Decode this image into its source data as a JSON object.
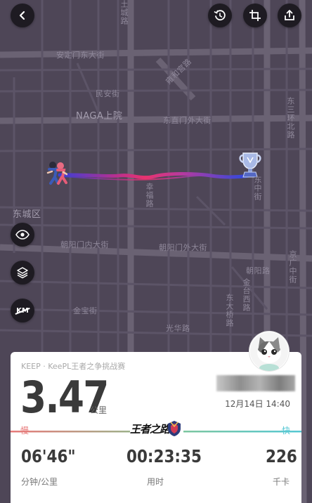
{
  "map": {
    "labels": {
      "tu_cheng": "土城路",
      "anding": "安定门东大街",
      "yonghe": "雍和宫路",
      "minan": "民安街",
      "naga": "NAGA上院",
      "dongzhi": "东直门外大街",
      "dongsan_huan": "东三环北路",
      "dongzhong": "东中街",
      "dongcheng": "东城区",
      "chaoyang_nei": "朝阳门内大街",
      "chaoyang_wai": "朝阳门外大街",
      "chaoyang_road": "朝阳路",
      "jinbao": "金宝街",
      "jintai": "金台西路",
      "dongda": "东大桥路",
      "jingguang": "京广中街",
      "guanghua": "光华路",
      "xingfu": "幸福路"
    }
  },
  "controls": {
    "back": "back-icon",
    "replay": "replay-icon",
    "crop": "crop-icon",
    "share": "share-icon",
    "visibility": "eye-icon",
    "layers": "layers-icon",
    "km_toggle": "KM"
  },
  "card": {
    "source": "KEEP · KeePL王者之争挑战赛",
    "distance": "3.47",
    "distance_unit": "公里",
    "datetime": "12月14日 14:40",
    "slow": "慢",
    "fast": "快",
    "event_logo": "王者之路",
    "stats": [
      {
        "value": "06'46\"",
        "label": "分钟/公里"
      },
      {
        "value": "00:23:35",
        "label": "用时"
      },
      {
        "value": "226",
        "label": "千卡"
      }
    ]
  },
  "colors": {
    "map_bg": "#4e4657",
    "route_start": "#3b3fd6",
    "route_mid": "#e8336f",
    "route_end": "#2a4ae0",
    "slow": "#e87a7a",
    "fast": "#56c8d4"
  }
}
